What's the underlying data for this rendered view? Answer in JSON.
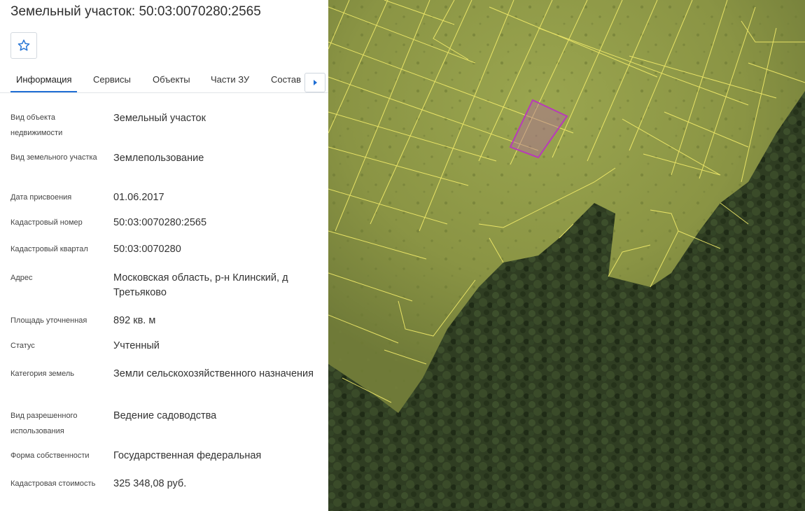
{
  "panel": {
    "title": "Земельный участок: 50:03:0070280:2565",
    "favorite_icon": "star-outline-icon",
    "tabs": [
      {
        "label": "Информация",
        "active": true
      },
      {
        "label": "Сервисы",
        "active": false
      },
      {
        "label": "Объекты",
        "active": false
      },
      {
        "label": "Части ЗУ",
        "active": false
      },
      {
        "label": "Состав",
        "active": false
      }
    ],
    "tabs_next_icon": "caret-right-icon",
    "fields": [
      {
        "label": "Вид объекта недвижимости",
        "value": "Земельный участок"
      },
      {
        "label": "Вид земельного участка",
        "value": "Землепользование"
      },
      {
        "label": "Дата присвоения",
        "value": "01.06.2017"
      },
      {
        "label": "Кадастровый номер",
        "value": "50:03:0070280:2565"
      },
      {
        "label": "Кадастровый квартал",
        "value": "50:03:0070280"
      },
      {
        "label": "Адрес",
        "value": "Московская область, р-н Клинский, д Третьяково"
      },
      {
        "label": "Площадь уточненная",
        "value": "892 кв. м"
      },
      {
        "label": "Статус",
        "value": "Учтенный"
      },
      {
        "label": "Категория земель",
        "value": "Земли сельскохозяйственного назначения"
      },
      {
        "label": "Вид разрешенного использования",
        "value": "Ведение садоводства"
      },
      {
        "label": "Форма собственности",
        "value": "Государственная федеральная"
      },
      {
        "label": "Кадастровая стоимость",
        "value": "325 348,08 руб."
      }
    ]
  },
  "map": {
    "layer": "satellite-imagery",
    "parcel_border_color": "#f3ec6a",
    "selected_parcel_color": "#b83bb8",
    "field_color": "#8c9a46",
    "forest_color": "#2f3e22"
  }
}
